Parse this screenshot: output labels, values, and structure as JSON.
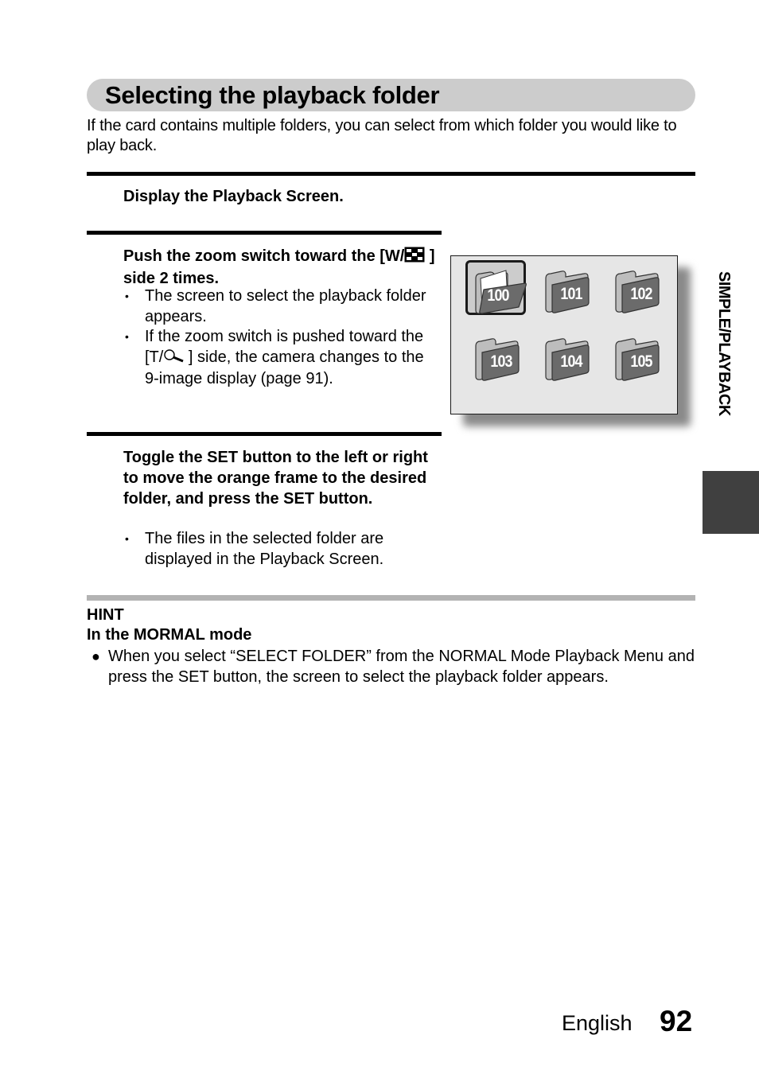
{
  "page": {
    "title": "Selecting the playback folder",
    "intro": "If the card contains multiple folders, you can select from which folder you would like to play back.",
    "side_tab_label": "SIMPLE/PLAYBACK",
    "footer": {
      "language": "English",
      "page_number": "92"
    },
    "colors": {
      "title_bar": "#cccccc",
      "side_tab": "#404040",
      "hint_rule": "#b3b3b3",
      "screen_bg": "#e6e6e6",
      "folder_dark": "#6b6b6b"
    }
  },
  "steps": [
    {
      "heading": "Display the Playback Screen.",
      "bullets": []
    },
    {
      "heading_part1": "Push the zoom switch toward the [W/",
      "heading_icon": "thumbnail-grid-icon",
      "heading_part2": " ] side 2 times.",
      "bullets": [
        "The screen to select the playback folder appears.",
        {
          "part1": "If the zoom switch is pushed toward the [T/",
          "icon": "magnifier-icon",
          "part2": " ] side, the camera changes to the 9-image display (page 91)."
        }
      ]
    },
    {
      "heading": "Toggle the SET button to the left or right to move the orange frame to the desired folder, and press the SET button.",
      "bullets": [
        "The files in the selected folder are displayed in the Playback Screen."
      ]
    }
  ],
  "folder_screen": {
    "folders": [
      "100",
      "101",
      "102",
      "103",
      "104",
      "105"
    ],
    "selected": "100"
  },
  "hint": {
    "title": "HINT",
    "subtitle": "In the MORMAL mode",
    "bullet_symbol": "●",
    "text": "When you select “SELECT FOLDER” from the NORMAL Mode Playback Menu and press the SET button, the screen to select the playback folder appears."
  },
  "bullet_symbol": "•"
}
